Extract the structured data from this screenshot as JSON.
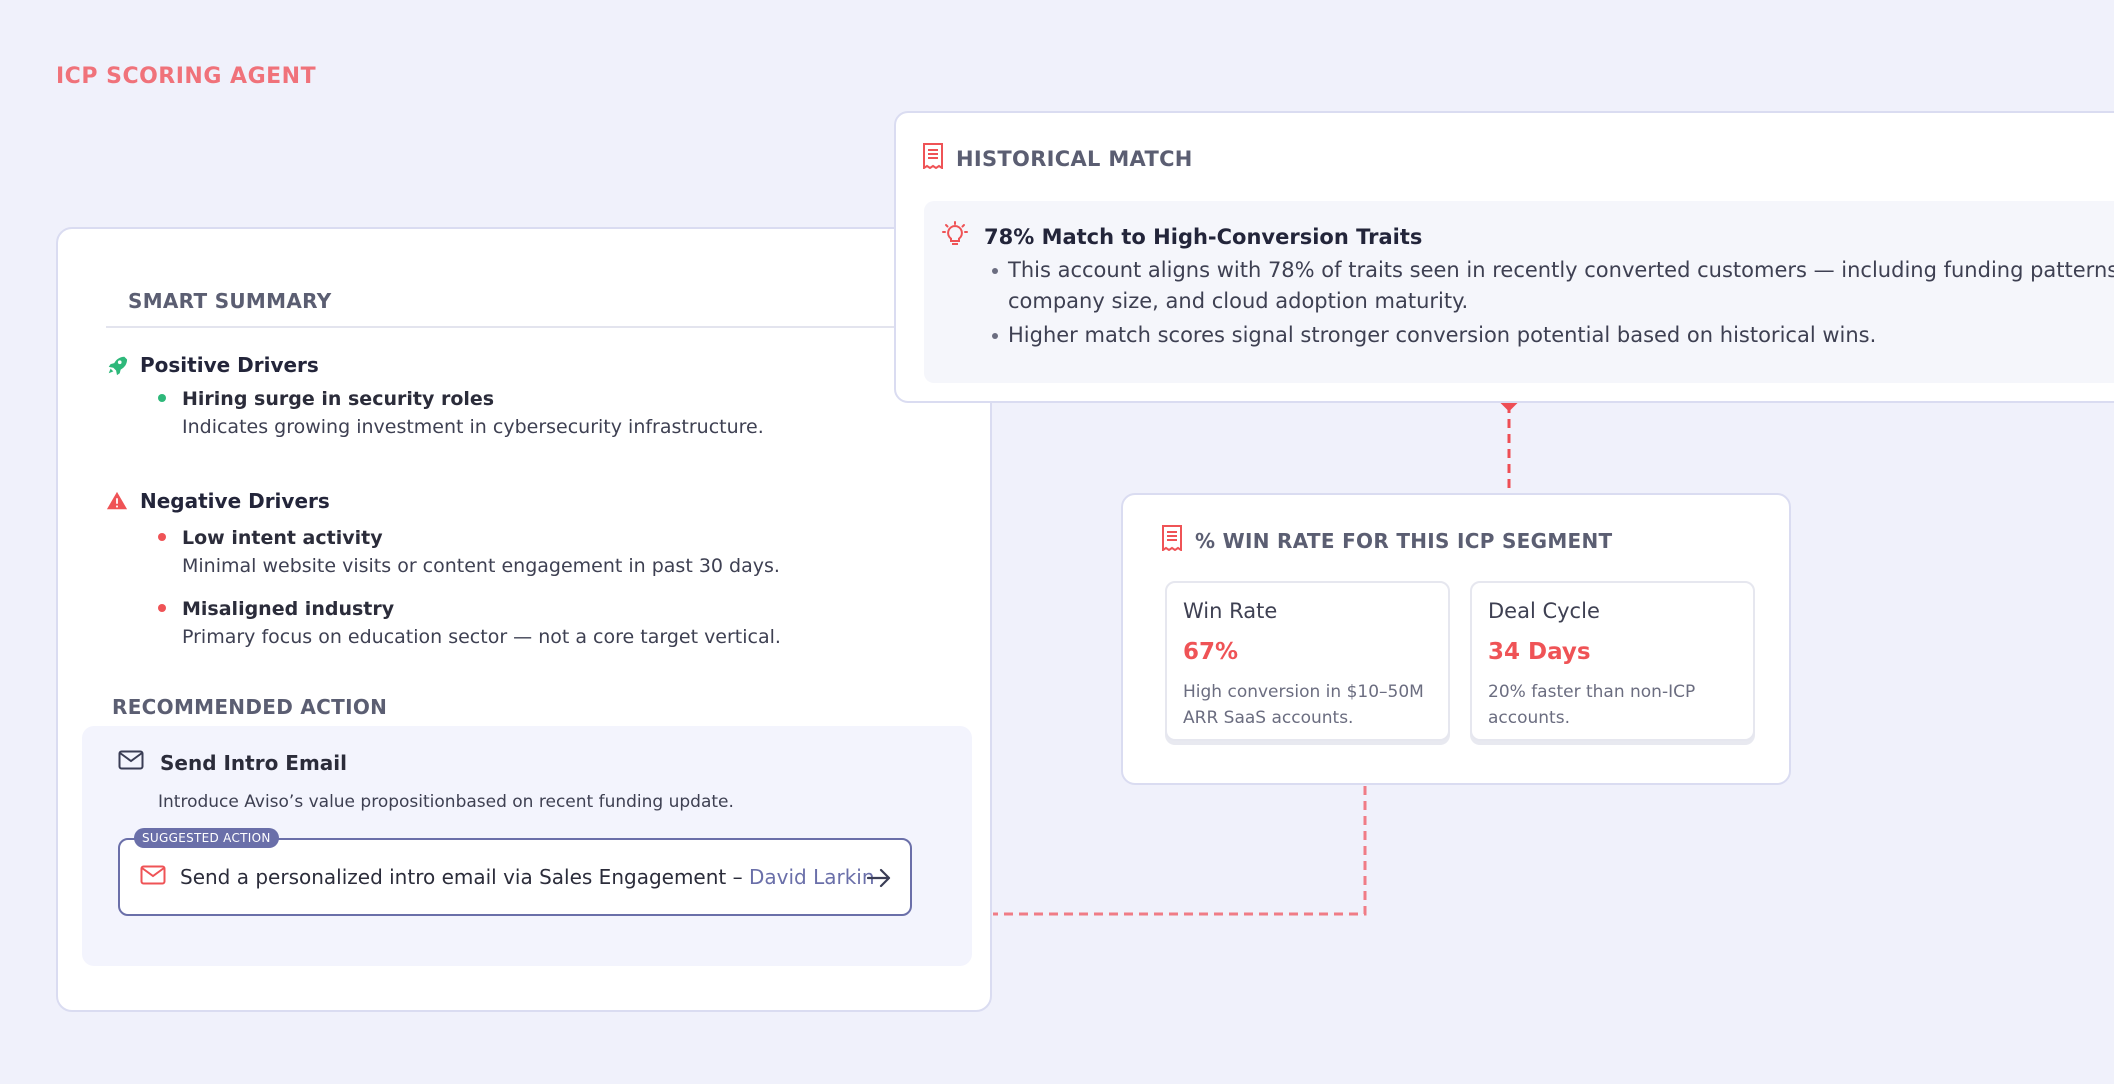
{
  "page": {
    "title": "ICP SCORING AGENT"
  },
  "summary": {
    "heading": "SMART SUMMARY",
    "positive": {
      "title": "Positive Drivers",
      "items": [
        {
          "title": "Hiring surge in security roles",
          "description": "Indicates growing investment in cybersecurity infrastructure."
        }
      ]
    },
    "negative": {
      "title": "Negative Drivers",
      "items": [
        {
          "title": "Low intent activity",
          "description": "Minimal website visits or content engagement in past 30 days."
        },
        {
          "title": "Misaligned industry",
          "description": "Primary focus on education sector — not a core target vertical."
        }
      ]
    }
  },
  "recommended": {
    "heading": "RECOMMENDED ACTION",
    "title": "Send Intro Email",
    "description": "Introduce Aviso’s value propositionbased on recent funding update.",
    "suggestion": {
      "badge": "SUGGESTED ACTION",
      "text": "Send a personalized intro email via Sales Engagement –",
      "contact": "David Larkin"
    }
  },
  "historical": {
    "heading": "HISTORICAL MATCH",
    "title": "78% Match to High-Conversion Traits",
    "bullets": [
      "This account aligns with 78% of traits seen in recently converted customers — including funding patterns, company size, and cloud adoption maturity.",
      "Higher match scores signal stronger conversion potential based on historical wins."
    ]
  },
  "winrate": {
    "heading": "% WIN RATE FOR THIS ICP SEGMENT",
    "metrics": [
      {
        "label": "Win Rate",
        "value": "67%",
        "note": "High conversion in $10–50M ARR SaaS accounts."
      },
      {
        "label": "Deal Cycle",
        "value": "34 Days",
        "note": "20% faster than non-ICP accounts."
      }
    ]
  },
  "colors": {
    "accent_red": "#ef5356",
    "title_pink": "#f0727a",
    "positive_green": "#2eb87a",
    "link_purple": "#6a6fa9",
    "background": "#f0f1fb"
  },
  "icons": {
    "positive": "rocket-icon",
    "negative": "warning-icon",
    "email": "mail-icon",
    "historical": "receipt-icon",
    "insight": "lightbulb-icon",
    "winrate": "receipt-icon",
    "arrow": "arrow-right-icon"
  }
}
